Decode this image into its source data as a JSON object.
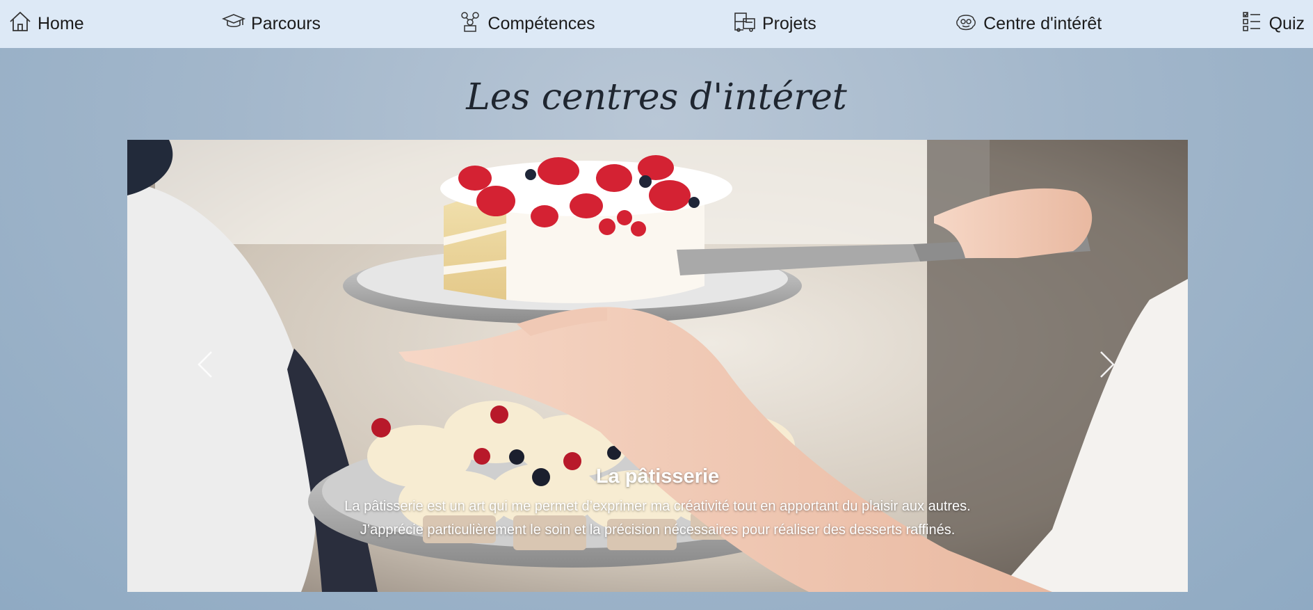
{
  "nav": {
    "items": [
      {
        "label": "Home",
        "icon": "home-icon"
      },
      {
        "label": "Parcours",
        "icon": "graduation-cap-icon"
      },
      {
        "label": "Compétences",
        "icon": "skills-icon"
      },
      {
        "label": "Projets",
        "icon": "projects-icon"
      },
      {
        "label": "Centre d'intérêt",
        "icon": "interests-icon"
      },
      {
        "label": "Quiz",
        "icon": "checklist-icon"
      }
    ]
  },
  "page": {
    "title": "Les centres d'intéret"
  },
  "carousel": {
    "slide_image": "cake-and-cupcakes-photo",
    "prev_icon": "chevron-left-icon",
    "next_icon": "chevron-right-icon",
    "caption": {
      "title": "La pâtisserie",
      "line1": "La pâtisserie est un art qui me permet d’exprimer ma créativité tout en apportant du plaisir aux autres.",
      "line2": "J’apprécie particulièrement le soin et la précision nécessaires pour réaliser des desserts raffinés."
    }
  },
  "colors": {
    "navbar_bg": "#dde9f6",
    "page_bg": "#a3b7cb",
    "caption_text": "#ffffff"
  }
}
